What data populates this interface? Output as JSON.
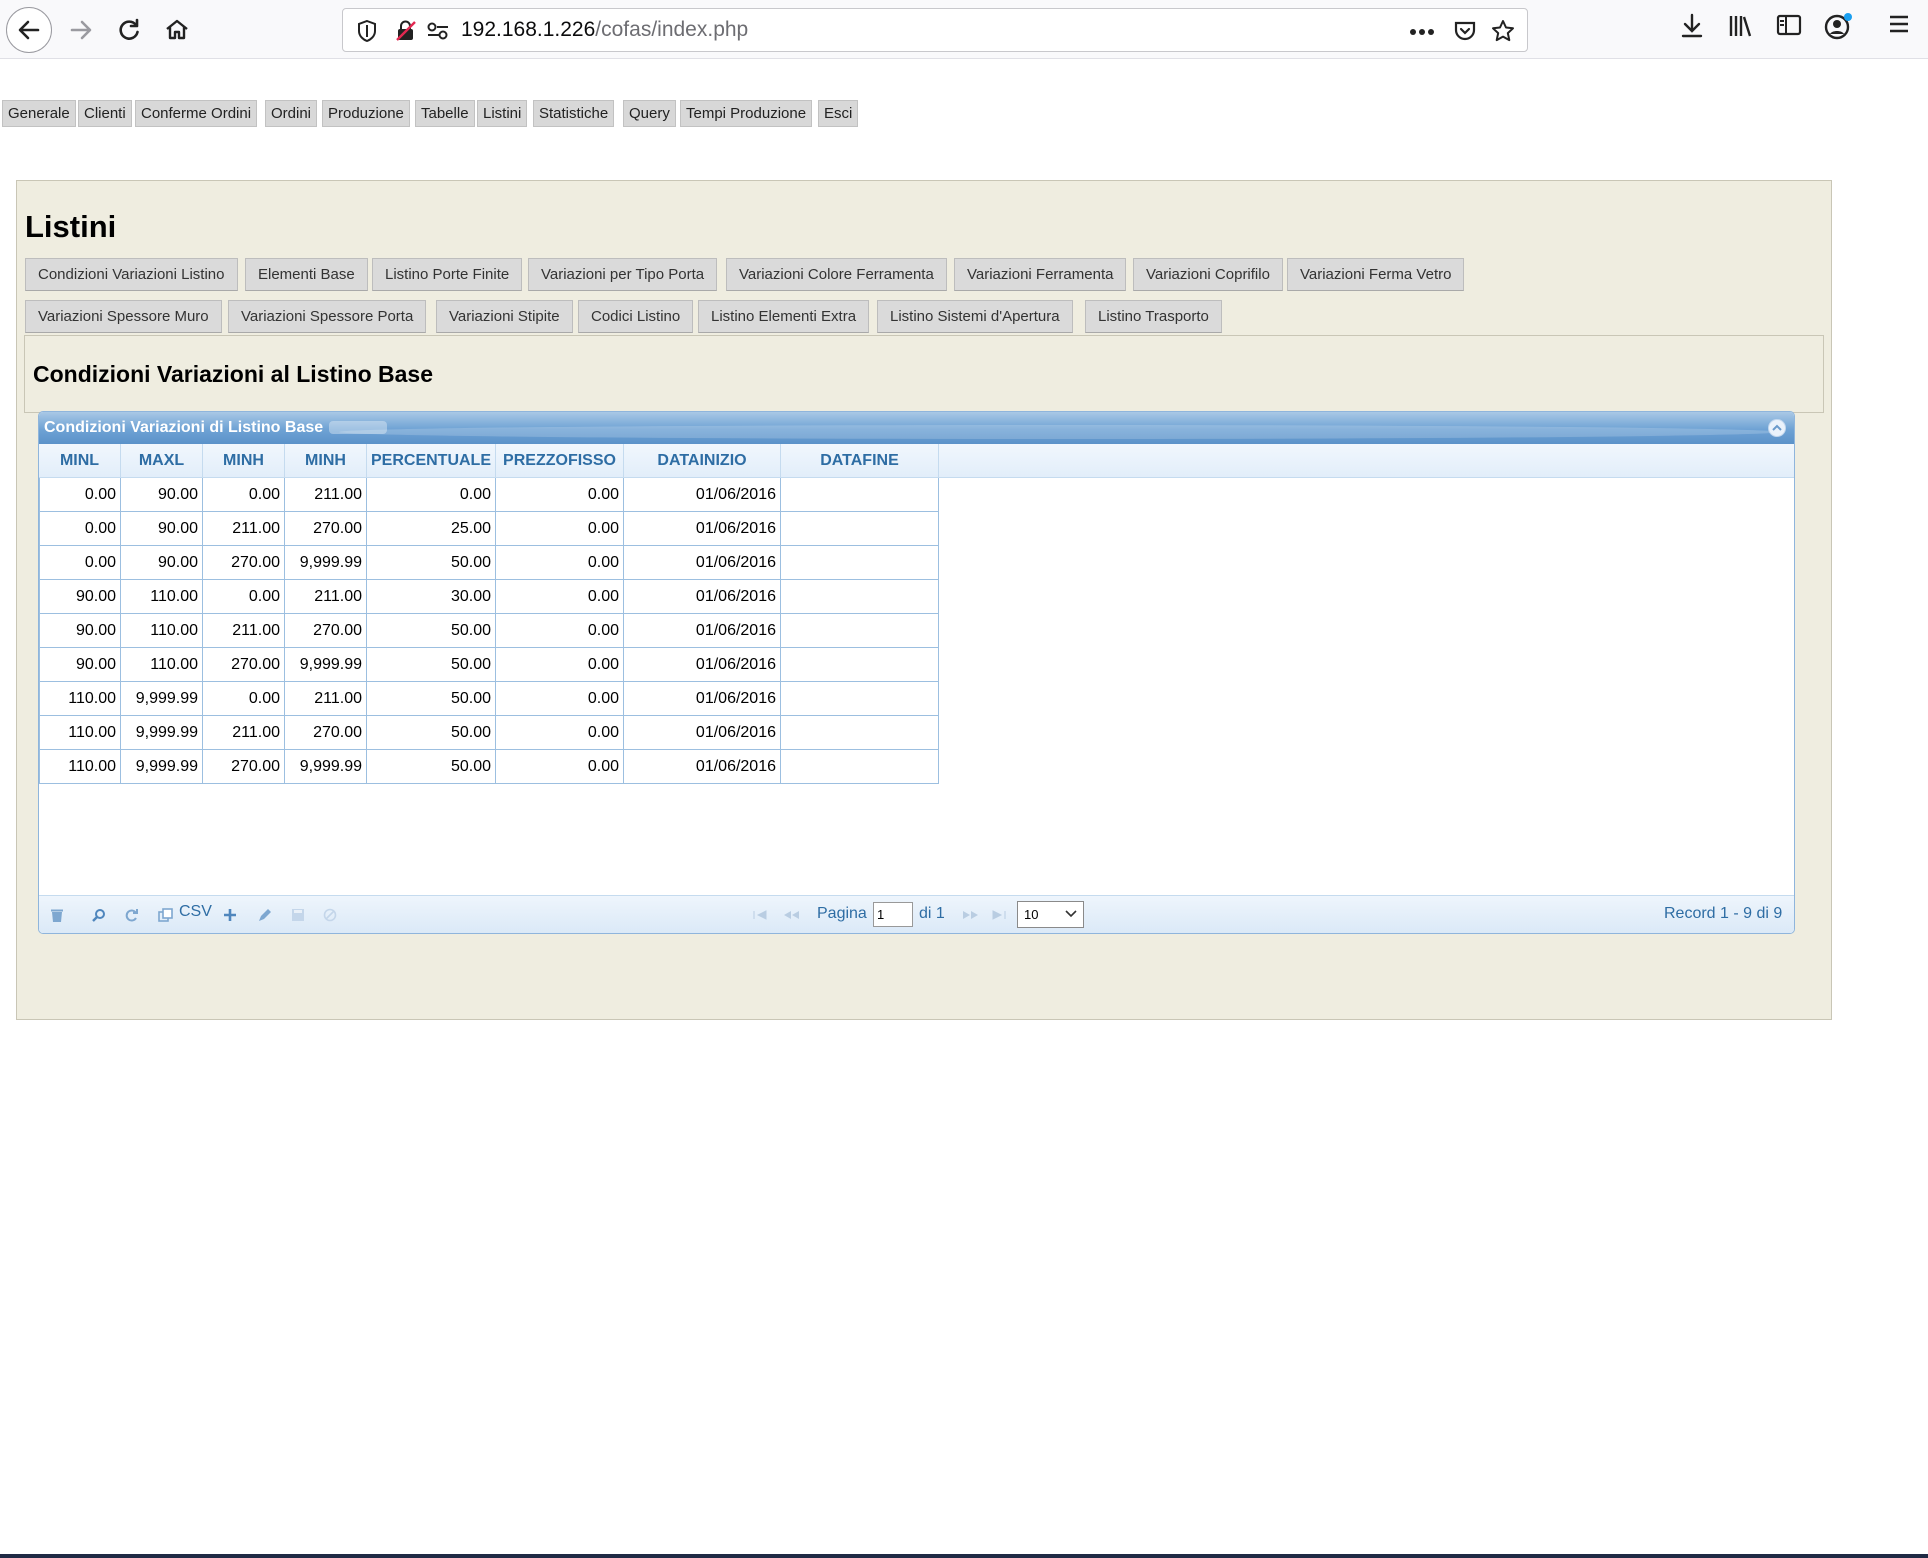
{
  "browser": {
    "url_host": "192.168.1.226",
    "url_path": "/cofas/index.php"
  },
  "topmenu": [
    "Generale",
    "Clienti",
    "Conferme Ordini",
    "Ordini",
    "Produzione",
    "Tabelle",
    "Listini",
    "Statistiche",
    "Query",
    "Tempi Produzione",
    "Esci"
  ],
  "page": {
    "title": "Listini"
  },
  "subtabs_row1": [
    "Condizioni Variazioni Listino",
    "Elementi Base",
    "Listino Porte Finite",
    "Variazioni per Tipo Porta",
    "Variazioni Colore Ferramenta",
    "Variazioni Ferramenta",
    "Variazioni Coprifilo",
    "Variazioni Ferma Vetro"
  ],
  "subtabs_row2": [
    "Variazioni Spessore Muro",
    "Variazioni Spessore Porta",
    "Variazioni Stipite",
    "Codici Listino",
    "Listino Elementi Extra",
    "Listino Sistemi d'Apertura",
    "Listino Trasporto"
  ],
  "section": {
    "title": "Condizioni Variazioni al Listino Base"
  },
  "grid": {
    "caption": "Condizioni Variazioni di Listino Base",
    "columns": [
      "MINL",
      "MAXL",
      "MINH",
      "MINH",
      "PERCENTUALE",
      "PREZZOFISSO",
      "DATAINIZIO",
      "DATAFINE"
    ],
    "rows": [
      [
        "0.00",
        "90.00",
        "0.00",
        "211.00",
        "0.00",
        "0.00",
        "01/06/2016",
        ""
      ],
      [
        "0.00",
        "90.00",
        "211.00",
        "270.00",
        "25.00",
        "0.00",
        "01/06/2016",
        ""
      ],
      [
        "0.00",
        "90.00",
        "270.00",
        "9,999.99",
        "50.00",
        "0.00",
        "01/06/2016",
        ""
      ],
      [
        "90.00",
        "110.00",
        "0.00",
        "211.00",
        "30.00",
        "0.00",
        "01/06/2016",
        ""
      ],
      [
        "90.00",
        "110.00",
        "211.00",
        "270.00",
        "50.00",
        "0.00",
        "01/06/2016",
        ""
      ],
      [
        "90.00",
        "110.00",
        "270.00",
        "9,999.99",
        "50.00",
        "0.00",
        "01/06/2016",
        ""
      ],
      [
        "110.00",
        "9,999.99",
        "0.00",
        "211.00",
        "50.00",
        "0.00",
        "01/06/2016",
        ""
      ],
      [
        "110.00",
        "9,999.99",
        "211.00",
        "270.00",
        "50.00",
        "0.00",
        "01/06/2016",
        ""
      ],
      [
        "110.00",
        "9,999.99",
        "270.00",
        "9,999.99",
        "50.00",
        "0.00",
        "01/06/2016",
        ""
      ]
    ],
    "pager": {
      "csv_label": "CSV",
      "page_label": "Pagina",
      "page_value": "1",
      "of_label": "di 1",
      "rows_per_page": "10",
      "record_info": "Record 1 - 9 di 9"
    }
  },
  "colors": {
    "panel_bg": "#efede0",
    "grid_header_text": "#2e6da4",
    "caption_blue": "#6ea2d4"
  }
}
